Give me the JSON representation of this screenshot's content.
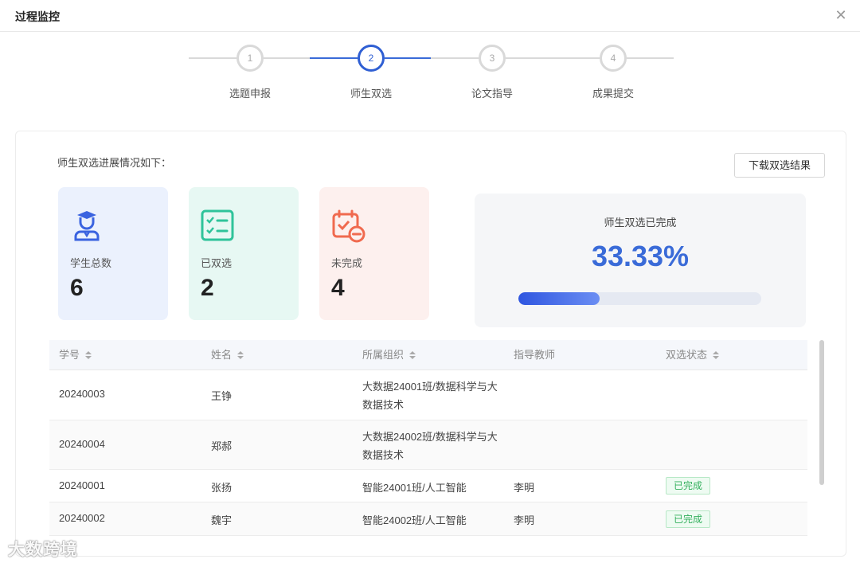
{
  "dialog": {
    "title": "过程监控",
    "close_icon": "close-icon"
  },
  "steps": [
    {
      "num": "1",
      "label": "选题申报",
      "active": false
    },
    {
      "num": "2",
      "label": "师生双选",
      "active": true
    },
    {
      "num": "3",
      "label": "论文指导",
      "active": false
    },
    {
      "num": "4",
      "label": "成果提交",
      "active": false
    }
  ],
  "panel": {
    "intro": "师生双选进展情况如下：",
    "download_label": "下载双选结果"
  },
  "stats": [
    {
      "label": "学生总数",
      "value": "6",
      "icon": "student-icon",
      "bg": "#ebf1fd",
      "color": "#3a63e0"
    },
    {
      "label": "已双选",
      "value": "2",
      "icon": "checklist-icon",
      "bg": "#e7f8f3",
      "color": "#2fc39a"
    },
    {
      "label": "未完成",
      "value": "4",
      "icon": "calendar-minus-icon",
      "bg": "#fdf0ee",
      "color": "#f06a4f"
    }
  ],
  "progress": {
    "title": "师生双选已完成",
    "percent_text": "33.33%",
    "value": 0.3333
  },
  "table": {
    "headers": [
      "学号",
      "姓名",
      "所属组织",
      "指导教师",
      "双选状态"
    ],
    "rows": [
      {
        "id": "20240003",
        "name": "王铮",
        "org": "大数据24001班/数据科学与大数据技术",
        "teacher": "",
        "status": ""
      },
      {
        "id": "20240004",
        "name": "郑郝",
        "org": "大数据24002班/数据科学与大数据技术",
        "teacher": "",
        "status": ""
      },
      {
        "id": "20240001",
        "name": "张扬",
        "org": "智能24001班/人工智能",
        "teacher": "李明",
        "status": "已完成"
      },
      {
        "id": "20240002",
        "name": "魏宇",
        "org": "智能24002班/人工智能",
        "teacher": "李明",
        "status": "已完成"
      }
    ]
  },
  "watermark": "大数跨境"
}
